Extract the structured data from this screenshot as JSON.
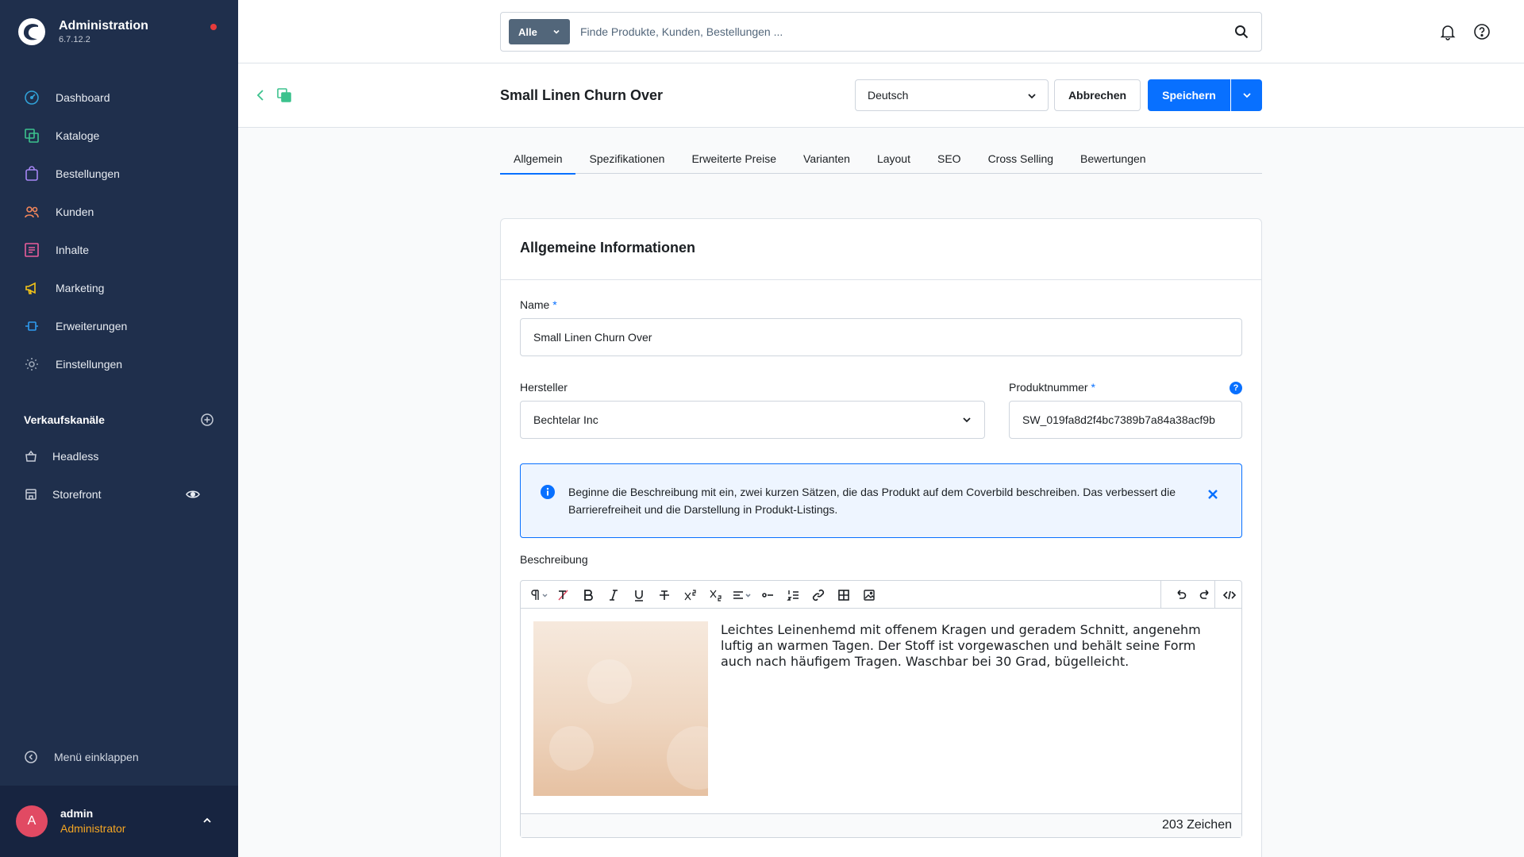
{
  "brand": {
    "title": "Administration",
    "version": "6.7.12.2"
  },
  "nav": [
    {
      "label": "Dashboard",
      "icon": "dashboard-icon"
    },
    {
      "label": "Kataloge",
      "icon": "catalog-icon"
    },
    {
      "label": "Bestellungen",
      "icon": "orders-icon"
    },
    {
      "label": "Kunden",
      "icon": "customers-icon"
    },
    {
      "label": "Inhalte",
      "icon": "content-icon"
    },
    {
      "label": "Marketing",
      "icon": "marketing-icon"
    },
    {
      "label": "Erweiterungen",
      "icon": "extensions-icon"
    },
    {
      "label": "Einstellungen",
      "icon": "settings-icon"
    }
  ],
  "sales_channels": {
    "header": "Verkaufskanäle",
    "items": [
      {
        "label": "Headless",
        "icon": "headless-icon"
      },
      {
        "label": "Storefront",
        "icon": "storefront-icon"
      }
    ]
  },
  "collapse_label": "Menü einklappen",
  "user": {
    "initial": "A",
    "name": "admin",
    "role": "Administrator"
  },
  "search": {
    "type_label": "Alle",
    "placeholder": "Finde Produkte, Kunden, Bestellungen ..."
  },
  "smartbar": {
    "title": "Small Linen Churn Over",
    "language": "Deutsch",
    "cancel_label": "Abbrechen",
    "save_label": "Speichern"
  },
  "tabs": [
    "Allgemein",
    "Spezifikationen",
    "Erweiterte Preise",
    "Varianten",
    "Layout",
    "SEO",
    "Cross Selling",
    "Bewertungen"
  ],
  "active_tab": "Allgemein",
  "card": {
    "title": "Allgemeine Informationen",
    "name_label": "Name",
    "name_value": "Small Linen Churn Over",
    "manufacturer_label": "Hersteller",
    "manufacturer_value": "Bechtelar Inc",
    "product_number_label": "Produktnummer",
    "product_number_value": "SW_019fa8d2f4bc7389b7a84a38acf9b",
    "required_mark": "*",
    "help_mark": "?",
    "info_text": "Beginne die Beschreibung mit ein, zwei kurzen Sätzen, die das Produkt auf dem Coverbild beschreiben. Das verbessert die Barrierefreiheit und die Darstellung in Produkt-Listings.",
    "description_label": "Beschreibung",
    "description_text": "Leichtes Leinenhemd mit offenem Kragen und geradem Schnitt, angenehm luftig an warmen Tagen. Der Stoff ist vorgewaschen und behält seine Form auch nach häufigem Tragen. Waschbar bei 30 Grad, bügelleicht.",
    "char_count": "203 Zeichen"
  },
  "colors": {
    "sidebar": "#1f2f4c",
    "primary": "#0870ff",
    "role": "#f5a623",
    "avatar": "#e14a63"
  }
}
